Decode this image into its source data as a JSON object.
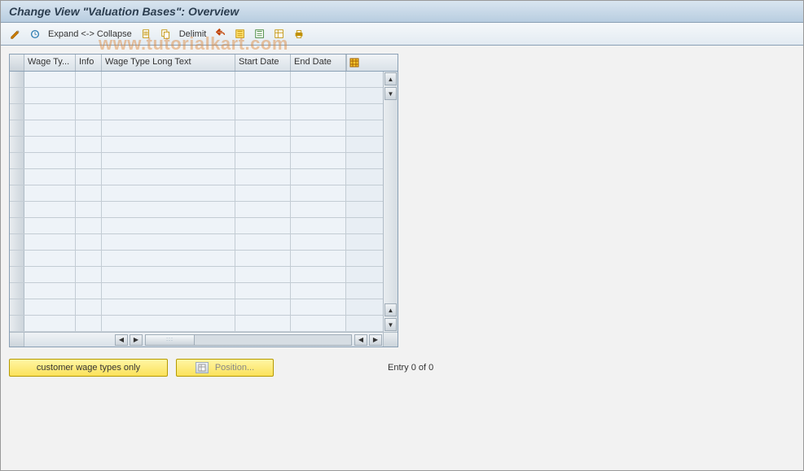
{
  "title": "Change View \"Valuation Bases\": Overview",
  "toolbar": {
    "expand_collapse_label": "Expand <-> Collapse",
    "delimit_label": "Delimit"
  },
  "grid": {
    "columns": {
      "wage_type": "Wage Ty...",
      "info": "Info",
      "wage_long": "Wage Type Long Text",
      "start_date": "Start Date",
      "end_date": "End Date"
    },
    "rows": [
      {
        "wage_type": "",
        "info": "",
        "wage_long": "",
        "start_date": "",
        "end_date": ""
      },
      {
        "wage_type": "",
        "info": "",
        "wage_long": "",
        "start_date": "",
        "end_date": ""
      },
      {
        "wage_type": "",
        "info": "",
        "wage_long": "",
        "start_date": "",
        "end_date": ""
      },
      {
        "wage_type": "",
        "info": "",
        "wage_long": "",
        "start_date": "",
        "end_date": ""
      },
      {
        "wage_type": "",
        "info": "",
        "wage_long": "",
        "start_date": "",
        "end_date": ""
      },
      {
        "wage_type": "",
        "info": "",
        "wage_long": "",
        "start_date": "",
        "end_date": ""
      },
      {
        "wage_type": "",
        "info": "",
        "wage_long": "",
        "start_date": "",
        "end_date": ""
      },
      {
        "wage_type": "",
        "info": "",
        "wage_long": "",
        "start_date": "",
        "end_date": ""
      },
      {
        "wage_type": "",
        "info": "",
        "wage_long": "",
        "start_date": "",
        "end_date": ""
      },
      {
        "wage_type": "",
        "info": "",
        "wage_long": "",
        "start_date": "",
        "end_date": ""
      },
      {
        "wage_type": "",
        "info": "",
        "wage_long": "",
        "start_date": "",
        "end_date": ""
      },
      {
        "wage_type": "",
        "info": "",
        "wage_long": "",
        "start_date": "",
        "end_date": ""
      },
      {
        "wage_type": "",
        "info": "",
        "wage_long": "",
        "start_date": "",
        "end_date": ""
      },
      {
        "wage_type": "",
        "info": "",
        "wage_long": "",
        "start_date": "",
        "end_date": ""
      },
      {
        "wage_type": "",
        "info": "",
        "wage_long": "",
        "start_date": "",
        "end_date": ""
      },
      {
        "wage_type": "",
        "info": "",
        "wage_long": "",
        "start_date": "",
        "end_date": ""
      }
    ]
  },
  "buttons": {
    "customer_wage": "customer wage types only",
    "position": "Position..."
  },
  "status": {
    "entry_text": "Entry 0 of 0"
  },
  "watermark": "www.tutorialkart.com"
}
